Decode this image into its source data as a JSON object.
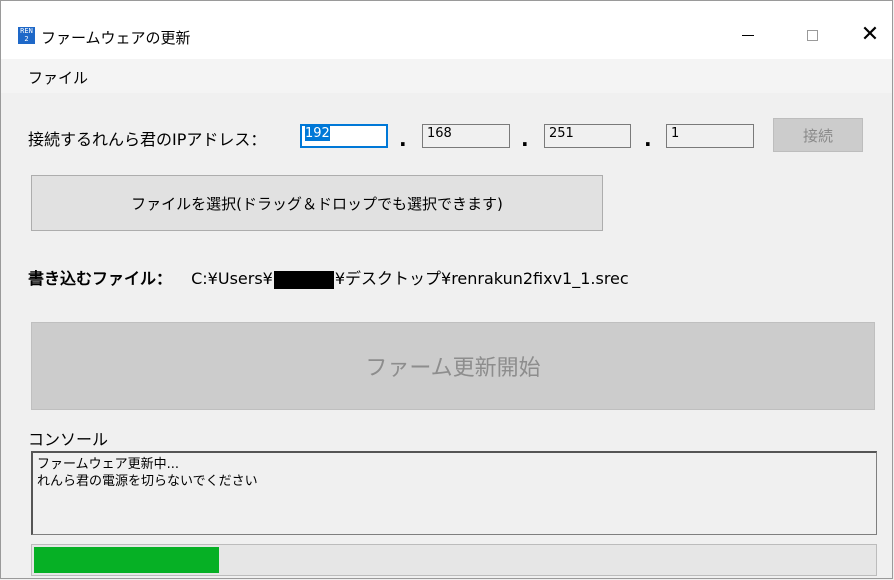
{
  "window": {
    "title": "ファームウェアの更新",
    "app_icon_text": "REN 2",
    "minimize": "—",
    "maximize": "☐",
    "close": "✕"
  },
  "menu": {
    "items": [
      "ファイル"
    ]
  },
  "connection": {
    "label": "接続するれんら君のIPアドレス：",
    "ip_octets": [
      "192",
      "168",
      "251",
      "1"
    ],
    "separator": ".",
    "connect_button": "接続"
  },
  "file_select": {
    "button_label": "ファイルを選択(ドラッグ＆ドロップでも選択できます)"
  },
  "target_file": {
    "label": "書き込むファイル：",
    "path_prefix": "C:¥Users¥",
    "path_suffix": "¥デスクトップ¥renrakun2fixv1_1.srec"
  },
  "start_button": {
    "label": "ファーム更新開始"
  },
  "console": {
    "label": "コンソール",
    "lines": [
      "ファームウェア更新中...",
      "れんら君の電源を切らないでください"
    ]
  },
  "progress": {
    "fraction": 0.22,
    "color": "#06b025"
  }
}
